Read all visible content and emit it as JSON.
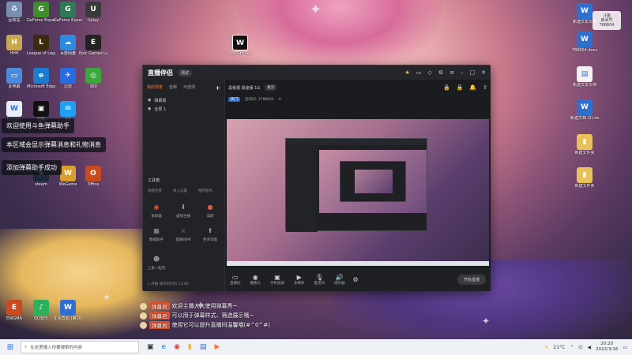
{
  "notifications": [
    "欢迎使用斗鱼弹幕助手",
    "本区域会显示弹幕消息和礼物消息",
    "添加弹幕助手成功"
  ],
  "desktop_icons_left": [
    {
      "label": "回收站",
      "color": "#7a8fb0",
      "glyph": "♻"
    },
    {
      "label": "GeForce Experience",
      "color": "#3e8e2b",
      "glyph": "G"
    },
    {
      "label": "GeForce Experience",
      "color": "#2d7a55",
      "glyph": "G"
    },
    {
      "label": "Uplay",
      "color": "#3a3a3a",
      "glyph": "U"
    },
    {
      "label": "HHH",
      "color": "#caa64c",
      "glyph": "H"
    },
    {
      "label": "League of Legends",
      "color": "#3b2c10",
      "glyph": "L"
    },
    {
      "label": "百度网盘",
      "color": "#2c8be0",
      "glyph": "☁"
    },
    {
      "label": "Epic Games Launcher",
      "color": "#222",
      "glyph": "E"
    },
    {
      "label": "此电脑",
      "color": "#4a8be0",
      "glyph": "▭"
    },
    {
      "label": "Microsoft Edge",
      "color": "#1b7bd0",
      "glyph": "e"
    },
    {
      "label": "迅雷",
      "color": "#2b6be0",
      "glyph": "✈"
    },
    {
      "label": "360",
      "color": "#3ea63e",
      "glyph": "◎"
    },
    {
      "label": "tes.png",
      "color": "#e7eef8",
      "glyph": "W"
    },
    {
      "label": "剪映",
      "color": "#111",
      "glyph": "▣"
    },
    {
      "label": "QQ",
      "color": "#1da1f2",
      "glyph": "✉"
    },
    {
      "label": "Office",
      "color": "#c94a1e",
      "glyph": "O"
    },
    {
      "label": "steam",
      "color": "#1b2838",
      "glyph": "S"
    },
    {
      "label": "WeGame",
      "color": "#d8a02a",
      "glyph": "W"
    }
  ],
  "desktop_icons_right": [
    {
      "label": "新建文本文档",
      "color": "#2f6fd0",
      "glyph": "W"
    },
    {
      "label": "788604.docx",
      "color": "#2f6fd0",
      "glyph": "W"
    },
    {
      "label": "新建文本文档",
      "color": "#f1f1f1",
      "glyph": "▤"
    },
    {
      "label": "新建文档 (2).docx",
      "color": "#2f6fd0",
      "glyph": "W"
    },
    {
      "label": "新建文件夹",
      "color": "#e8c15a",
      "glyph": "▮"
    },
    {
      "label": "新建文件夹",
      "color": "#e8c15a",
      "glyph": "▮"
    }
  ],
  "desktop_icons_bottom": [
    {
      "label": "ENIGMA",
      "color": "#c94a1e",
      "glyph": "E"
    },
    {
      "label": "QQ音乐",
      "color": "#2bb15c",
      "glyph": "♪"
    },
    {
      "label": "生化危机 (第10).docx",
      "color": "#2f6fd0",
      "glyph": "W"
    }
  ],
  "watch_icon": {
    "label": "WATCH_DO",
    "color": "#ffffff",
    "glyph": "W"
  },
  "app": {
    "logo": "直播伴侣",
    "badge": "测试",
    "left_tabs": [
      "我的场景",
      "音频",
      "可选项"
    ],
    "rows": [
      "弹幕视",
      "全屏 1"
    ],
    "tools_label": "工具箱",
    "tools_tabs": [
      "视频连麦",
      "录入设置",
      "推荐服务"
    ],
    "tools": [
      {
        "label": "录屏器",
        "glyph": "◉",
        "color": "#e25a34"
      },
      {
        "label": "虚拟主播",
        "glyph": "⬇",
        "color": "#9a9ba0"
      },
      {
        "label": "美颜",
        "glyph": "●",
        "color": "#e25a34"
      },
      {
        "label": "数据助手",
        "glyph": "▦",
        "color": "#9a9ba0"
      },
      {
        "label": "直播间PK",
        "glyph": "⚔",
        "color": "#e25a34"
      },
      {
        "label": "更多功能",
        "glyph": "⬆",
        "color": "#9a9ba0"
      },
      {
        "label": "上麦一起玩",
        "glyph": "☻",
        "color": "#9a9ba0"
      }
    ],
    "footer": "1.开播 操作时间为 15:00",
    "scene_title": "黑板报 极速版 1G",
    "scene_tag": "推流",
    "scene_sub": [
      "热门",
      "您的ID: 3788604",
      "0"
    ],
    "bottom_items": [
      {
        "label": "直播间",
        "glyph": "▭"
      },
      {
        "label": "摄像头",
        "glyph": "◉"
      },
      {
        "label": "手机投屏",
        "glyph": "▣"
      },
      {
        "label": "多媒体",
        "glyph": "▶"
      },
      {
        "label": "麦克风",
        "glyph": "🎙"
      },
      {
        "label": "扬声器",
        "glyph": "🔊"
      }
    ],
    "start_label": "开始直播"
  },
  "danmu": [
    {
      "name": "弹幕君",
      "text": "欢迎主播大大使用弹幕秀~"
    },
    {
      "name": "弹幕君",
      "text": "可以用于弹幕样式、筛选展示哦~"
    },
    {
      "name": "弹幕君",
      "text": "使用它可以提升直播间温馨哦(#^0^#)"
    }
  ],
  "top_logo": {
    "line1": "斗鱼",
    "line2": "房间号",
    "line3": "788604"
  },
  "taskbar": {
    "search_placeholder": "在这里输入你要搜索的内容",
    "weather": "21°C",
    "clock_time": "20:20",
    "clock_date": "2022/3/16"
  },
  "colors": {
    "accent": "#f57a35",
    "taskbar_bg": "#eef1f6"
  }
}
